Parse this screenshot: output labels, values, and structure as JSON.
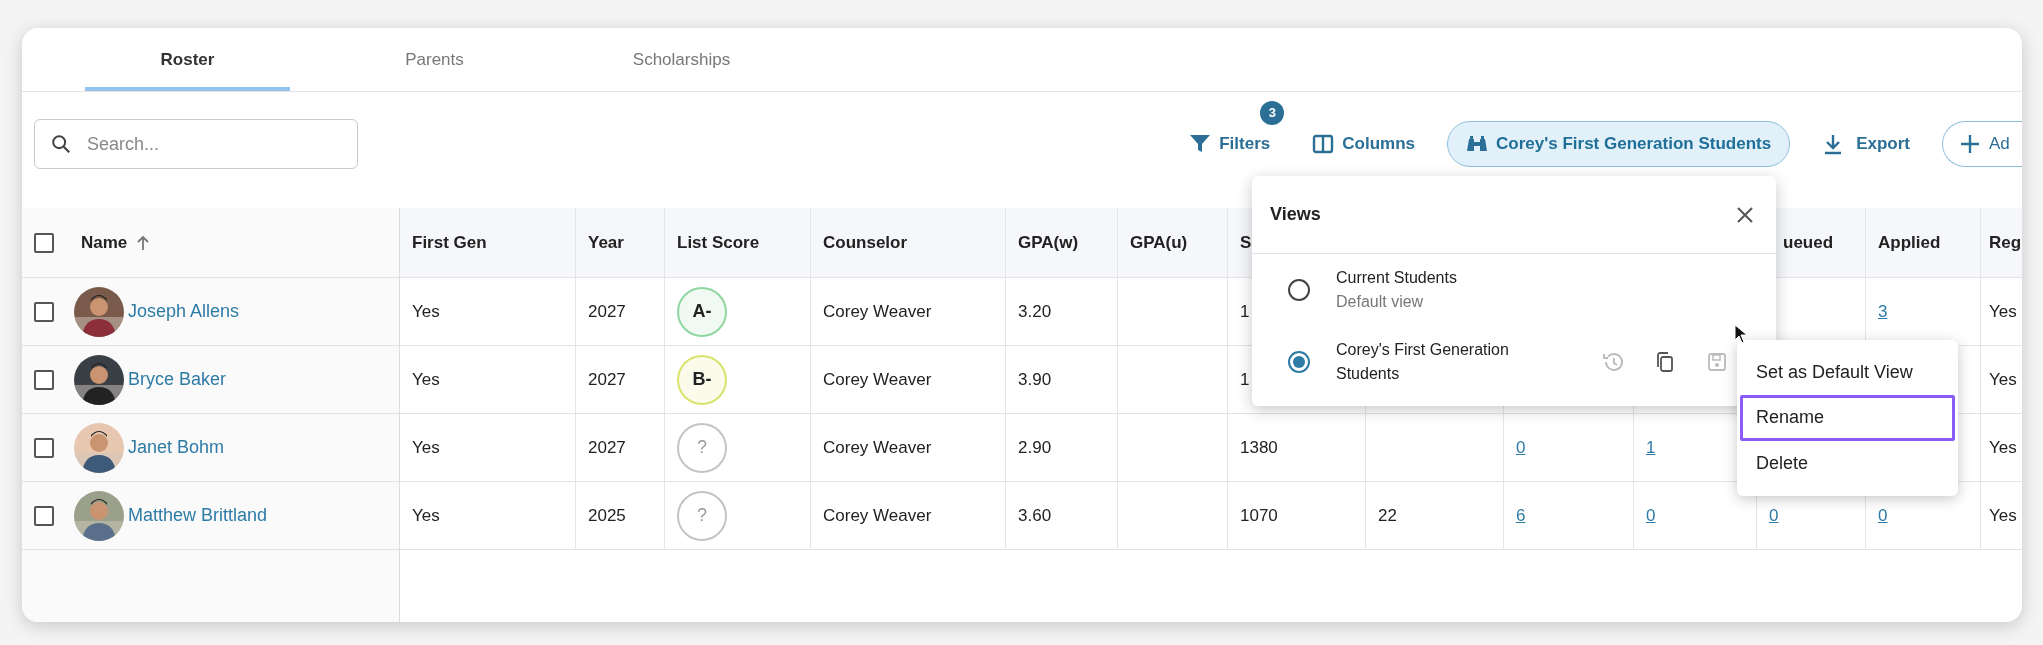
{
  "tabs": [
    {
      "label": "Roster",
      "selected": true
    },
    {
      "label": "Parents",
      "selected": false
    },
    {
      "label": "Scholarships",
      "selected": false
    }
  ],
  "search": {
    "placeholder": "Search..."
  },
  "toolbar": {
    "filters": {
      "label": "Filters",
      "badge": "3"
    },
    "columns": {
      "label": "Columns"
    },
    "view": {
      "label": "Corey's First Generation Students"
    },
    "export": {
      "label": "Export"
    },
    "add": {
      "label": "Ad"
    }
  },
  "table": {
    "columns": [
      {
        "label": "First Gen",
        "kind": "text"
      },
      {
        "label": "Year",
        "kind": "text"
      },
      {
        "label": "List Score",
        "kind": "score"
      },
      {
        "label": "Counselor",
        "kind": "text"
      },
      {
        "label": "GPA(w)",
        "kind": "text"
      },
      {
        "label": "GPA(u)",
        "kind": "text"
      },
      {
        "label": "S",
        "kind": "text"
      },
      {
        "kind": "text"
      },
      {
        "kind": "link"
      },
      {
        "kind": "link"
      },
      {
        "label": "ueued",
        "kind": "link"
      },
      {
        "label": "Applied",
        "kind": "link"
      },
      {
        "label": "Reg",
        "kind": "text"
      }
    ],
    "name_column": {
      "label": "Name",
      "sorted": true
    },
    "select_all": {
      "checked": false
    },
    "rows": [
      {
        "checked": false,
        "name": "Joseph Allens",
        "cells": [
          "Yes",
          "2027",
          {
            "text": "A-",
            "color": "#8fd6a0"
          },
          "Corey Weaver",
          "3.20",
          null,
          "1",
          null,
          null,
          null,
          null,
          "3",
          "Yes"
        ]
      },
      {
        "checked": false,
        "name": "Bryce Baker",
        "cells": [
          "Yes",
          "2027",
          {
            "text": "B-",
            "color": "#d8e36a"
          },
          "Corey Weaver",
          "3.90",
          null,
          "1",
          null,
          null,
          null,
          null,
          null,
          "Yes"
        ]
      },
      {
        "checked": false,
        "name": "Janet Bohm",
        "cells": [
          "Yes",
          "2027",
          {
            "text": "?",
            "color": "#c4c4c4"
          },
          "Corey Weaver",
          "2.90",
          null,
          "1380",
          null,
          "0",
          "1",
          null,
          null,
          "Yes"
        ]
      },
      {
        "checked": false,
        "name": "Matthew Brittland",
        "cells": [
          "Yes",
          "2025",
          {
            "text": "?",
            "color": "#c4c4c4"
          },
          "Corey Weaver",
          "3.60",
          null,
          "1070",
          "22",
          "6",
          "0",
          "0",
          "0",
          "Yes"
        ]
      }
    ]
  },
  "views_popup": {
    "title": "Views",
    "items": [
      {
        "name": "Current Students",
        "subtitle": "Default view",
        "selected": false
      },
      {
        "name": "Corey's First Generation Students",
        "selected": true
      }
    ]
  },
  "context_menu": {
    "items": [
      {
        "label": "Set as Default View",
        "focused": false
      },
      {
        "label": "Rename",
        "focused": true
      },
      {
        "label": "Delete",
        "focused": false
      }
    ]
  }
}
